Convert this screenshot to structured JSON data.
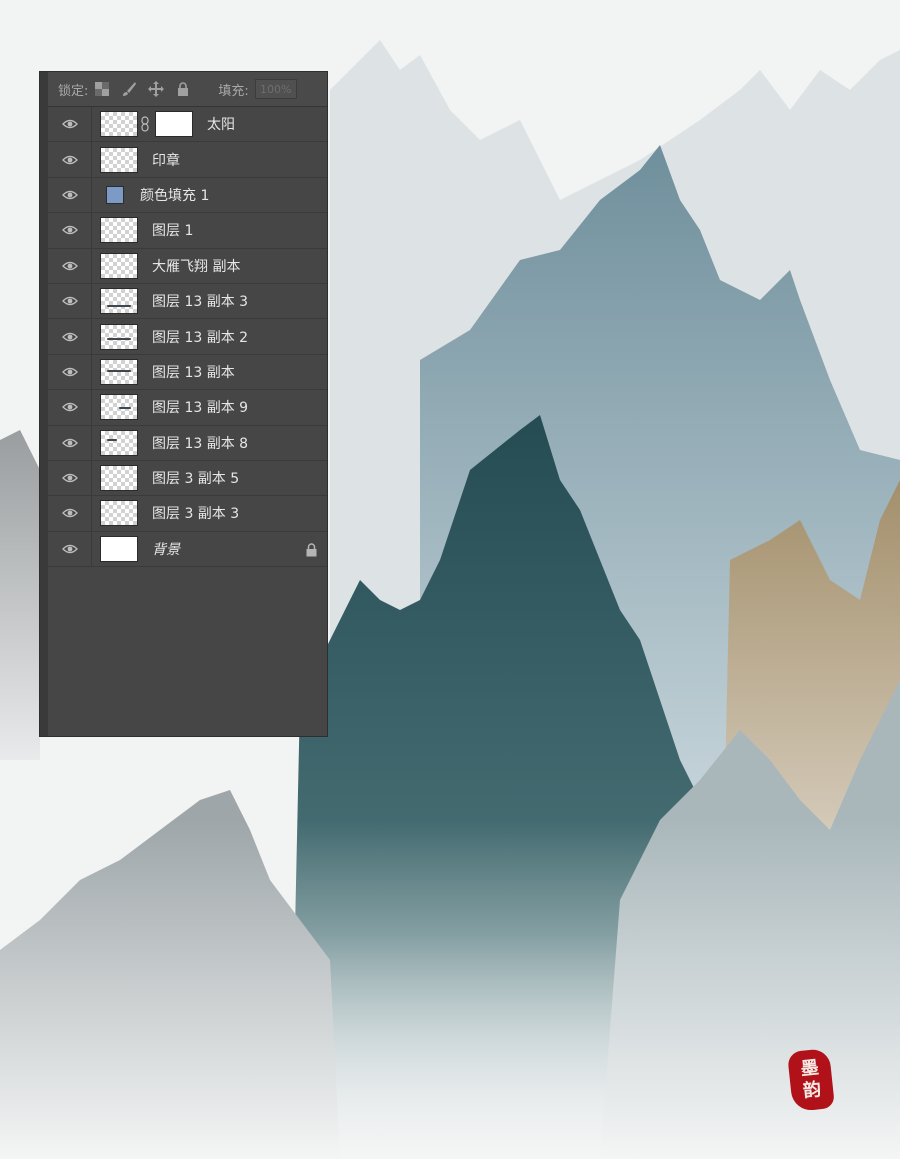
{
  "lock_bar": {
    "lock_label": "锁定:",
    "fill_label": "填充:",
    "fill_value": "100%"
  },
  "layers": [
    {
      "name": "太阳",
      "thumb": "transparent",
      "has_mask": true,
      "style": "normal"
    },
    {
      "name": "印章",
      "thumb": "transparent",
      "style": "normal"
    },
    {
      "name": "颜色填充 1",
      "thumb": "swatch",
      "swatch_color": "#7b9ac4",
      "style": "normal"
    },
    {
      "name": "图层 1",
      "thumb": "transparent",
      "style": "normal"
    },
    {
      "name": "大雁飞翔 副本",
      "thumb": "transparent",
      "style": "normal"
    },
    {
      "name": "图层 13 副本 3",
      "thumb": "transparent",
      "style": "normal"
    },
    {
      "name": "图层 13 副本 2",
      "thumb": "transparent",
      "style": "normal"
    },
    {
      "name": "图层 13 副本",
      "thumb": "transparent",
      "style": "normal"
    },
    {
      "name": "图层 13 副本 9",
      "thumb": "transparent",
      "style": "normal"
    },
    {
      "name": "图层 13 副本 8",
      "thumb": "transparent",
      "style": "normal"
    },
    {
      "name": "图层 3 副本 5",
      "thumb": "transparent",
      "style": "normal"
    },
    {
      "name": "图层 3 副本 3",
      "thumb": "transparent",
      "style": "normal"
    },
    {
      "name": "背景",
      "thumb": "white",
      "locked": true,
      "style": "italic"
    }
  ],
  "seal": {
    "chars": [
      "墨",
      "韵"
    ]
  },
  "colors": {
    "panel_bg": "#464646",
    "mountain_teal": "#2f5a60",
    "mountain_blue": "#8fadbb",
    "mountain_tan": "#a8987a",
    "seal_red": "#b1121a"
  }
}
